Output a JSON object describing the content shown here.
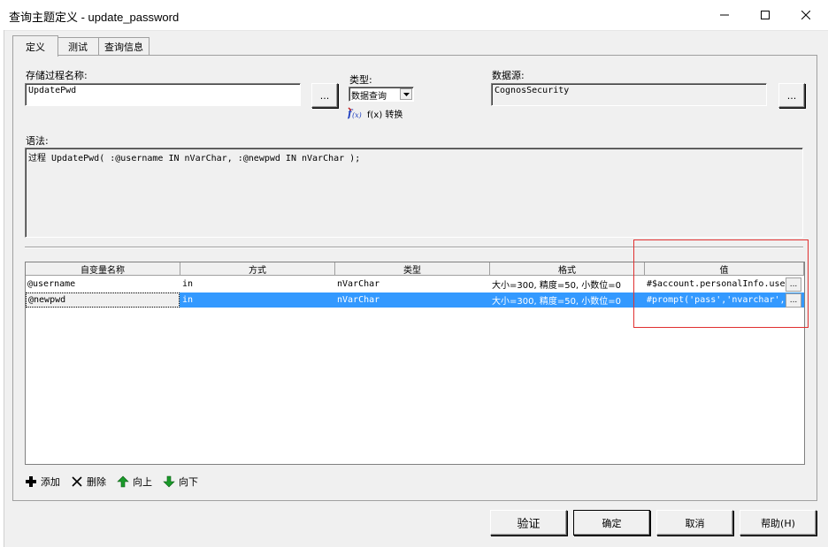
{
  "window": {
    "title": "查询主题定义 - update_password"
  },
  "tabs": [
    {
      "label": "定义"
    },
    {
      "label": "测试"
    },
    {
      "label": "查询信息"
    }
  ],
  "form": {
    "proc_name_label": "存储过程名称:",
    "proc_name_value": "UpdatePwd",
    "browse_label": "...",
    "type_label": "类型:",
    "type_value": "数据查询",
    "fx_label": "f(x) 转换",
    "datasource_label": "数据源:",
    "datasource_value": "CognosSecurity",
    "syntax_label": "语法:",
    "syntax_value": "过程 UpdatePwd( :@username IN nVarChar, :@newpwd IN nVarChar );"
  },
  "grid": {
    "columns": [
      "自变量名称",
      "方式",
      "类型",
      "格式",
      "值"
    ],
    "rows": [
      {
        "name": "@username",
        "mode": "in",
        "type": "nVarChar",
        "format": "大小=300, 精度=50, 小数位=0",
        "value": "#$account.personalInfo.userName#"
      },
      {
        "name": "@newpwd",
        "mode": "in",
        "type": "nVarChar",
        "format": "大小=300, 精度=50, 小数位=0",
        "value": "#prompt('pass','nvarchar','')#"
      }
    ],
    "selected_row": 1
  },
  "toolbar": {
    "add": "添加",
    "delete": "删除",
    "up": "向上",
    "down": "向下"
  },
  "buttons": {
    "validate": "验证",
    "ok": "确定",
    "cancel": "取消",
    "help": "帮助(H)"
  },
  "colors": {
    "selection": "#3399ff",
    "highlight_box": "#e03030"
  }
}
